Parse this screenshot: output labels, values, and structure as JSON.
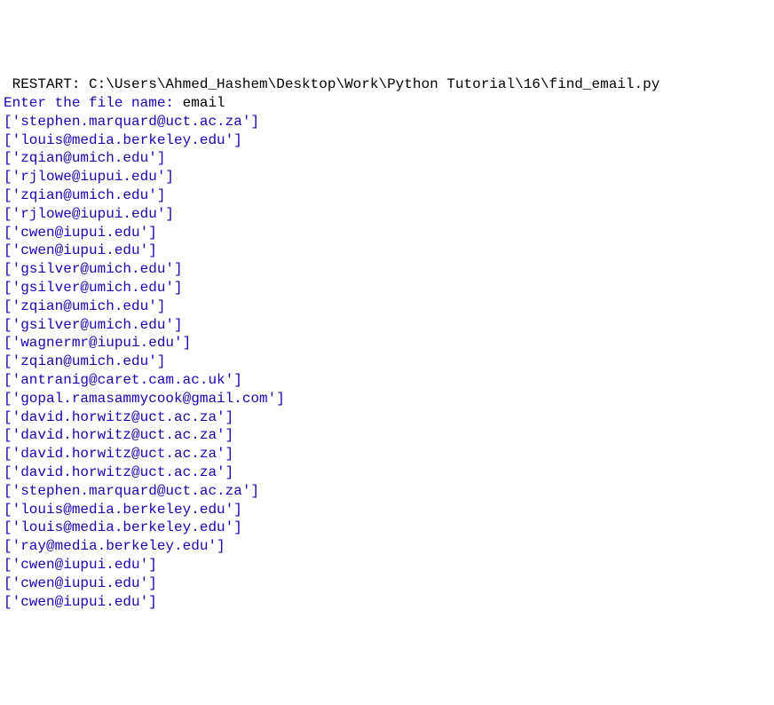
{
  "restart": {
    "label": " RESTART: ",
    "path": "C:\\Users\\Ahmed_Hashem\\Desktop\\Work\\Python Tutorial\\16\\find_email.py ",
    "trailing": ""
  },
  "prompt": {
    "text": "Enter the file name: ",
    "input": "email"
  },
  "output_lines": [
    "['stephen.marquard@uct.ac.za']",
    "['louis@media.berkeley.edu']",
    "['zqian@umich.edu']",
    "['rjlowe@iupui.edu']",
    "['zqian@umich.edu']",
    "['rjlowe@iupui.edu']",
    "['cwen@iupui.edu']",
    "['cwen@iupui.edu']",
    "['gsilver@umich.edu']",
    "['gsilver@umich.edu']",
    "['zqian@umich.edu']",
    "['gsilver@umich.edu']",
    "['wagnermr@iupui.edu']",
    "['zqian@umich.edu']",
    "['antranig@caret.cam.ac.uk']",
    "['gopal.ramasammycook@gmail.com']",
    "['david.horwitz@uct.ac.za']",
    "['david.horwitz@uct.ac.za']",
    "['david.horwitz@uct.ac.za']",
    "['david.horwitz@uct.ac.za']",
    "['stephen.marquard@uct.ac.za']",
    "['louis@media.berkeley.edu']",
    "['louis@media.berkeley.edu']",
    "['ray@media.berkeley.edu']",
    "['cwen@iupui.edu']",
    "['cwen@iupui.edu']",
    "['cwen@iupui.edu']"
  ]
}
